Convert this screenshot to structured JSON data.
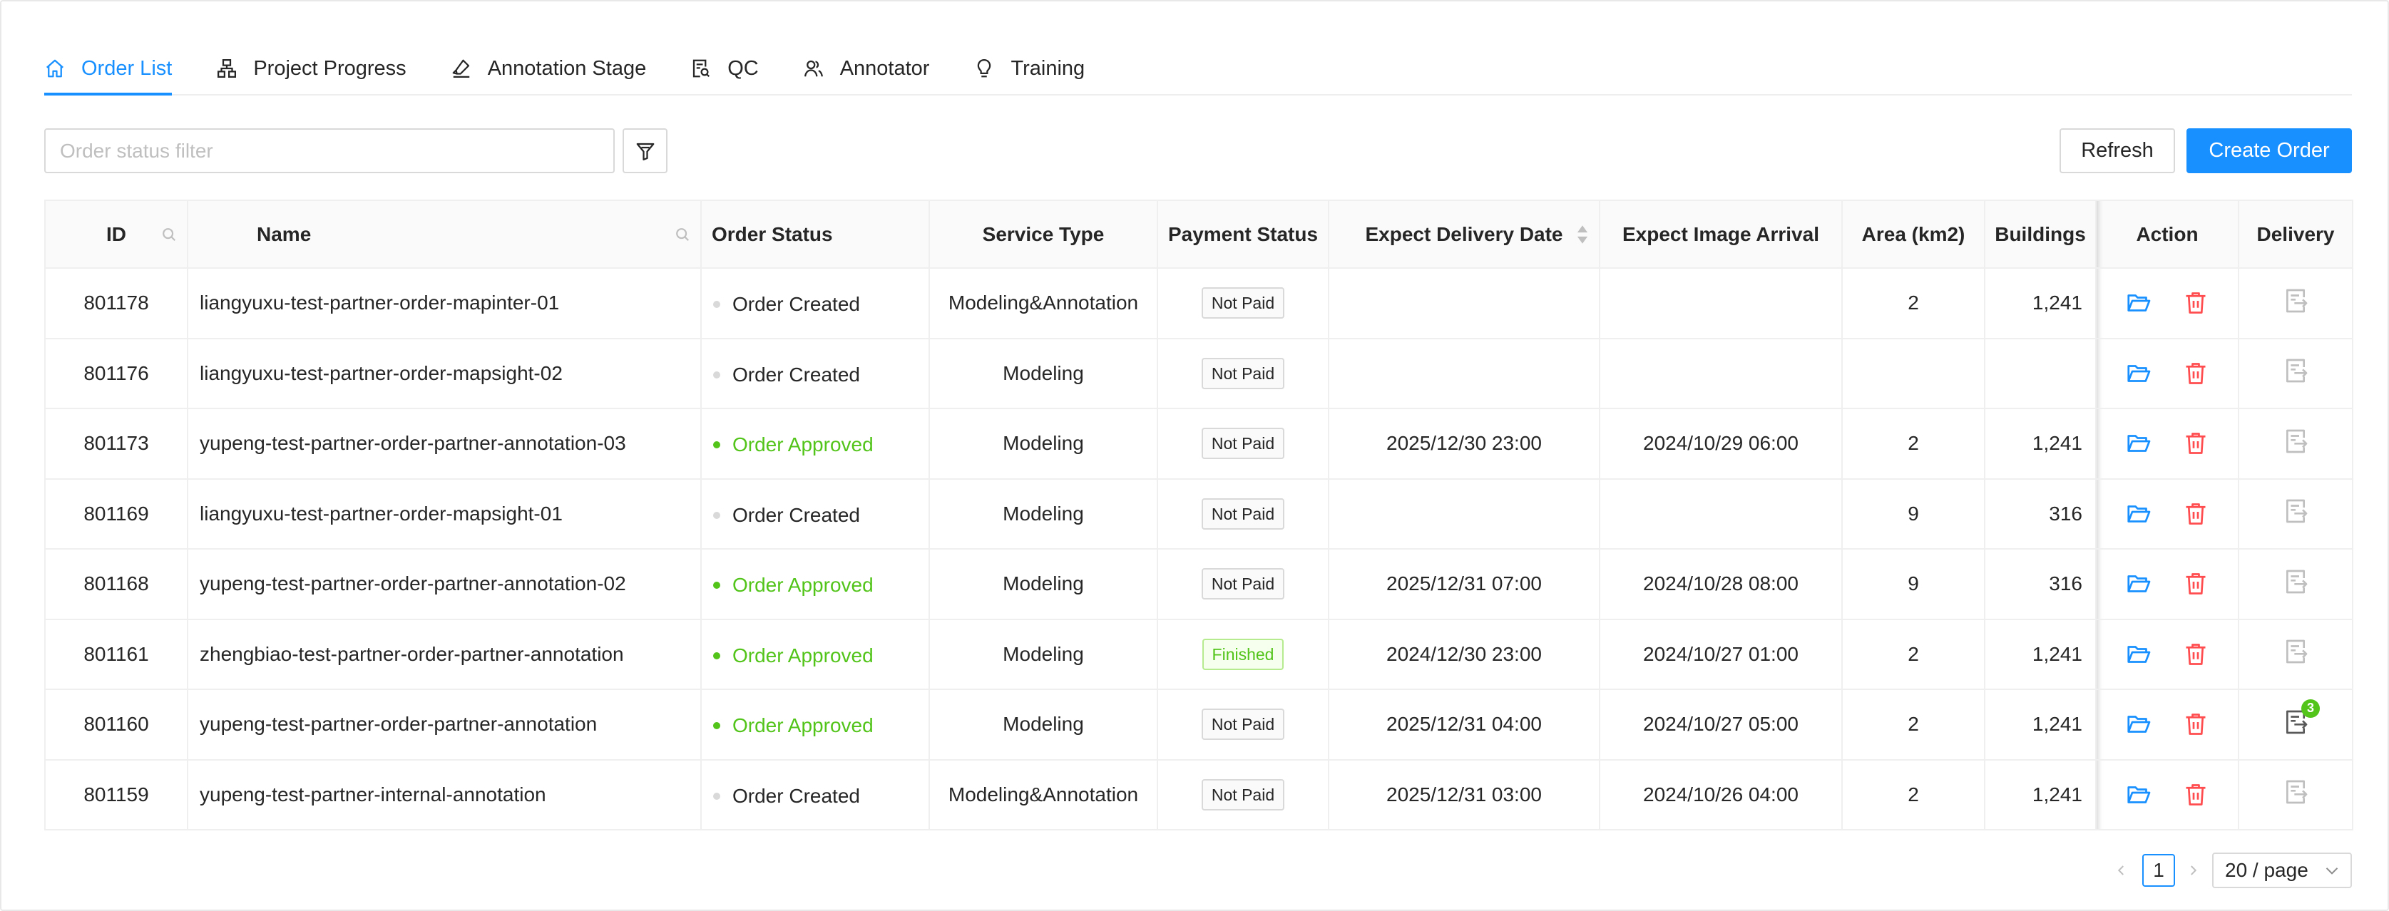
{
  "tabs": [
    {
      "label": "Order List",
      "icon": "home-icon",
      "active": true
    },
    {
      "label": "Project Progress",
      "icon": "hierarchy-icon"
    },
    {
      "label": "Annotation Stage",
      "icon": "highlight-icon"
    },
    {
      "label": "QC",
      "icon": "audit-icon"
    },
    {
      "label": "Annotator",
      "icon": "users-icon"
    },
    {
      "label": "Training",
      "icon": "bulb-icon"
    }
  ],
  "toolbar": {
    "filter_placeholder": "Order status filter",
    "filter_value": "",
    "refresh_label": "Refresh",
    "create_label": "Create Order"
  },
  "table": {
    "columns": {
      "id": "ID",
      "name": "Name",
      "order_status": "Order Status",
      "service_type": "Service Type",
      "payment_status": "Payment Status",
      "expect_delivery": "Expect Delivery Date",
      "expect_image": "Expect Image Arrival",
      "area": "Area (km2)",
      "buildings": "Buildings",
      "action": "Action",
      "delivery": "Delivery"
    },
    "rows": [
      {
        "id": "801178",
        "name": "liangyuxu-test-partner-order-mapinter-01",
        "status": "Order Created",
        "service": "Modeling&Annotation",
        "payment": "Not Paid",
        "delivery_date": "",
        "image_arrival": "",
        "area": "2",
        "buildings": "1,241",
        "delivery_badge": ""
      },
      {
        "id": "801176",
        "name": "liangyuxu-test-partner-order-mapsight-02",
        "status": "Order Created",
        "service": "Modeling",
        "payment": "Not Paid",
        "delivery_date": "",
        "image_arrival": "",
        "area": "",
        "buildings": "",
        "delivery_badge": ""
      },
      {
        "id": "801173",
        "name": "yupeng-test-partner-order-partner-annotation-03",
        "status": "Order Approved",
        "service": "Modeling",
        "payment": "Not Paid",
        "delivery_date": "2025/12/30 23:00",
        "image_arrival": "2024/10/29 06:00",
        "area": "2",
        "buildings": "1,241",
        "delivery_badge": ""
      },
      {
        "id": "801169",
        "name": "liangyuxu-test-partner-order-mapsight-01",
        "status": "Order Created",
        "service": "Modeling",
        "payment": "Not Paid",
        "delivery_date": "",
        "image_arrival": "",
        "area": "9",
        "buildings": "316",
        "delivery_badge": ""
      },
      {
        "id": "801168",
        "name": "yupeng-test-partner-order-partner-annotation-02",
        "status": "Order Approved",
        "service": "Modeling",
        "payment": "Not Paid",
        "delivery_date": "2025/12/31 07:00",
        "image_arrival": "2024/10/28 08:00",
        "area": "9",
        "buildings": "316",
        "delivery_badge": ""
      },
      {
        "id": "801161",
        "name": "zhengbiao-test-partner-order-partner-annotation",
        "status": "Order Approved",
        "service": "Modeling",
        "payment": "Finished",
        "delivery_date": "2024/12/30 23:00",
        "image_arrival": "2024/10/27 01:00",
        "area": "2",
        "buildings": "1,241",
        "delivery_badge": ""
      },
      {
        "id": "801160",
        "name": "yupeng-test-partner-order-partner-annotation",
        "status": "Order Approved",
        "service": "Modeling",
        "payment": "Not Paid",
        "delivery_date": "2025/12/31 04:00",
        "image_arrival": "2024/10/27 05:00",
        "area": "2",
        "buildings": "1,241",
        "delivery_badge": "3"
      },
      {
        "id": "801159",
        "name": "yupeng-test-partner-internal-annotation",
        "status": "Order Created",
        "service": "Modeling&Annotation",
        "payment": "Not Paid",
        "delivery_date": "2025/12/31 03:00",
        "image_arrival": "2024/10/26 04:00",
        "area": "2",
        "buildings": "1,241",
        "delivery_badge": ""
      }
    ]
  },
  "pagination": {
    "current_page": "1",
    "page_size": "20 / page"
  },
  "colors": {
    "primary": "#1890ff",
    "approved": "#52c41a",
    "created_dot": "#d9d9d9",
    "delete": "#ff4d4f",
    "disabled_icon": "#bfbfbf"
  }
}
